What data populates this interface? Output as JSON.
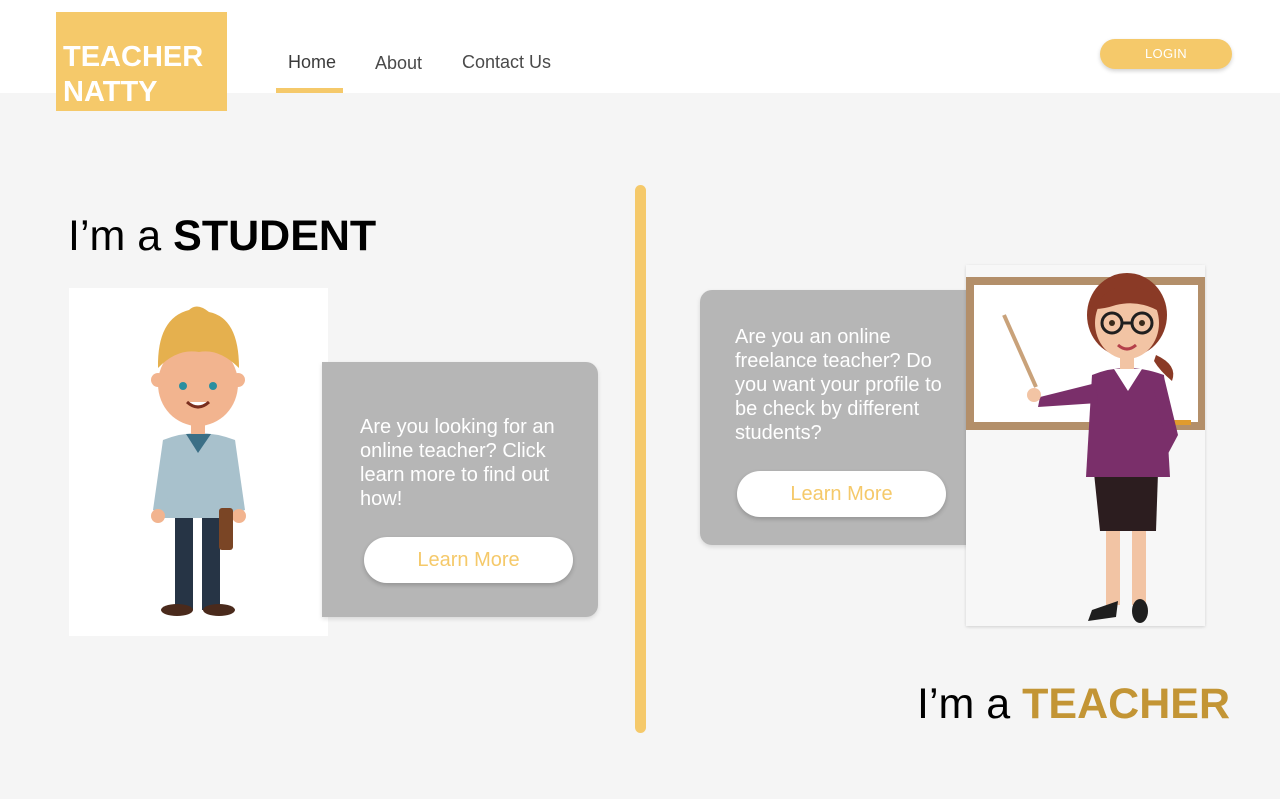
{
  "brand": {
    "line1": "TEACHER",
    "line2": "NATTY",
    "color": "#f5c96a"
  },
  "nav": {
    "items": [
      {
        "label": "Home",
        "active": true
      },
      {
        "label": "About",
        "active": false
      },
      {
        "label": "Contact Us",
        "active": false
      }
    ],
    "login_label": "LOGIN"
  },
  "student": {
    "heading_prefix": "I’m a",
    "heading_strong": "STUDENT",
    "description": "Are you looking for an online teacher? Click learn more to find out how!",
    "button_label": "Learn More",
    "image_icon": "student-illustration"
  },
  "teacher": {
    "heading_prefix": "I’m a",
    "heading_strong": "TEACHER",
    "description": "Are you an online freelance teacher? Do you want your profile to be check by different students?",
    "button_label": "Learn More",
    "image_icon": "teacher-illustration",
    "accent_color": "#c39535"
  },
  "colors": {
    "accent": "#f5c96a",
    "card": "#b6b6b6",
    "background": "#f5f5f5"
  }
}
